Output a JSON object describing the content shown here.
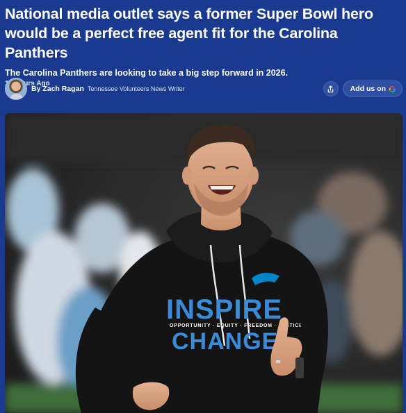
{
  "article": {
    "headline": "National media outlet says a former Super Bowl hero would be a perfect free agent fit for the Carolina Panthers",
    "subheadline": "The Carolina Panthers are looking to take a big step forward in 2026.",
    "timestamp": "15 Hours Ago"
  },
  "byline": {
    "author": "By Zach Ragan",
    "role": "Tennessee Volunteers News Writer"
  },
  "actions": {
    "share_icon": "share-icon",
    "add_us_label": "Add us on",
    "google_icon": "google-icon"
  },
  "hero_image": {
    "shirt_line1": "INSPIRE",
    "shirt_tagline": "OPPORTUNITY · EQUITY · FREEDOM · JUSTICE",
    "shirt_line2": "CHANGE"
  }
}
